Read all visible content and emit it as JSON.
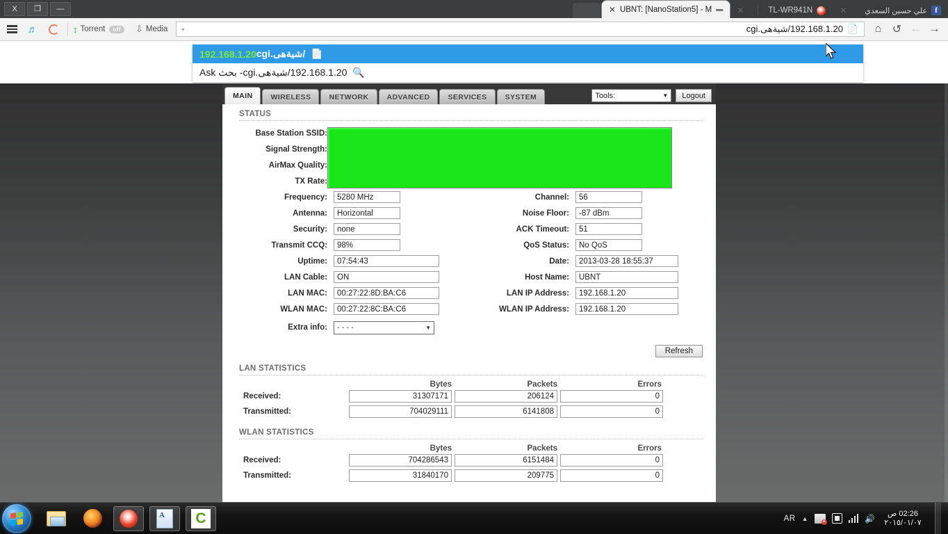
{
  "window": {
    "buttons": [
      {
        "name": "close",
        "glyph": "X"
      },
      {
        "name": "restore",
        "glyph": "❐"
      },
      {
        "name": "minimize",
        "glyph": "—"
      }
    ]
  },
  "browser": {
    "tabs": [
      {
        "id": "blank",
        "title": "",
        "type": "blank"
      },
      {
        "id": "active",
        "title": "UBNT: [NanoStation5] - M",
        "close": "✕",
        "favicon": "▬",
        "type": "active"
      },
      {
        "id": "t2",
        "title": "",
        "close": "✕",
        "type": "dim"
      },
      {
        "id": "t3",
        "title": "TL-WR941N",
        "favicon": "maxthon-icon",
        "type": "plain"
      },
      {
        "id": "t4",
        "title": "",
        "close": "✕",
        "type": "dim"
      },
      {
        "id": "t5",
        "title": "علي حسين السعدي",
        "favicon": "facebook-icon",
        "type": "plain"
      }
    ],
    "toolbar": {
      "menu_icon": "hamburger-icon",
      "headphones_icon": "headphones-icon",
      "maxthon_icon": "maxthon-logo-icon",
      "torrent_label": "Torrent",
      "torrent_state": "off",
      "media_label": "Media",
      "dropdown_caret": "▾"
    },
    "url": {
      "value": "192.168.1.20/شيةهى.cgi",
      "placeholder": "",
      "page_icon": "📄"
    },
    "nav": {
      "home": "⌂",
      "reload": "↺",
      "back": "←",
      "forward": "→"
    },
    "suggestions": [
      {
        "selected": true,
        "icon": "page-icon",
        "main": "192.168.1.20",
        "tail": "/شيةهى.cgi"
      },
      {
        "selected": false,
        "icon": "search-icon",
        "main": "192.168.1.20/شيةهى.cgi",
        "tail": " - بحث Ask"
      }
    ]
  },
  "router": {
    "nav_tabs": [
      {
        "label": "MAIN",
        "selected": true
      },
      {
        "label": "WIRELESS",
        "selected": false
      },
      {
        "label": "NETWORK",
        "selected": false
      },
      {
        "label": "ADVANCED",
        "selected": false
      },
      {
        "label": "SERVICES",
        "selected": false
      },
      {
        "label": "SYSTEM",
        "selected": false
      }
    ],
    "tools_label": "Tools:",
    "logout_label": "Logout",
    "status_title": "STATUS",
    "status_left": [
      {
        "label": "Base Station SSID:",
        "value": "",
        "hidden": true
      },
      {
        "label": "Signal Strength:",
        "value": "",
        "hidden": true
      },
      {
        "label": "AirMax Quality:",
        "value": "",
        "hidden": true
      },
      {
        "label": "TX Rate:",
        "value": "",
        "hidden": true
      },
      {
        "label": "Frequency:",
        "value": "5280 MHz",
        "hidden": false
      },
      {
        "label": "Antenna:",
        "value": "Horizontal",
        "hidden": false
      },
      {
        "label": "Security:",
        "value": "none",
        "hidden": false
      },
      {
        "label": "Transmit CCQ:",
        "value": "98%",
        "hidden": false
      },
      {
        "label": "Uptime:",
        "value": "07:54:43",
        "hidden": false
      },
      {
        "label": "LAN Cable:",
        "value": "ON",
        "hidden": false
      },
      {
        "label": "LAN MAC:",
        "value": "00:27:22:8D:BA:C6",
        "hidden": false
      },
      {
        "label": "WLAN MAC:",
        "value": "00:27:22:8C:BA:C6",
        "hidden": false
      }
    ],
    "status_right": [
      {
        "label": "Channel:",
        "value": "56"
      },
      {
        "label": "Noise Floor:",
        "value": "-87 dBm"
      },
      {
        "label": "ACK Timeout:",
        "value": "51"
      },
      {
        "label": "QoS Status:",
        "value": "No QoS"
      },
      {
        "label": "Date:",
        "value": "2013-03-28 18:55:37"
      },
      {
        "label": "Host Name:",
        "value": "UBNT"
      },
      {
        "label": "LAN IP Address:",
        "value": "192.168.1.20"
      },
      {
        "label": "WLAN IP Address:",
        "value": "192.168.1.20"
      }
    ],
    "extra_info": {
      "label": "Extra info:",
      "value": "- - - -",
      "caret": "▼"
    },
    "refresh_label": "Refresh",
    "lan_stats": {
      "title": "LAN STATISTICS",
      "columns": [
        "Bytes",
        "Packets",
        "Errors"
      ],
      "rows": [
        {
          "label": "Received:",
          "bytes": "31307171",
          "packets": "206124",
          "errors": "0"
        },
        {
          "label": "Transmitted:",
          "bytes": "704029111",
          "packets": "6141808",
          "errors": "0"
        }
      ]
    },
    "wlan_stats": {
      "title": "WLAN STATISTICS",
      "columns": [
        "Bytes",
        "Packets",
        "Errors"
      ],
      "rows": [
        {
          "label": "Received:",
          "bytes": "704286543",
          "packets": "6151484",
          "errors": "0"
        },
        {
          "label": "Transmitted:",
          "bytes": "31840170",
          "packets": "209775",
          "errors": "0"
        }
      ]
    }
  },
  "taskbar": {
    "start_label": "start-orb",
    "apps": [
      {
        "name": "explorer",
        "icon": "folder-icon",
        "open": false
      },
      {
        "name": "firefox",
        "icon": "firefox-icon",
        "open": false
      },
      {
        "name": "maxthon",
        "icon": "maxthon-icon",
        "open": true
      },
      {
        "name": "wordpad",
        "icon": "wordpad-icon",
        "open": true
      },
      {
        "name": "camtasia",
        "icon": "camtasia-icon",
        "open": true
      }
    ],
    "tray": {
      "language": "AR",
      "overflow_caret": "▲",
      "network_icon": "network-disconnected-icon",
      "power_icon": "power-plug-icon",
      "signal_icon": "signal-bars-icon",
      "volume_icon": "volume-icon",
      "time": "02:26 ص",
      "date": "٢٠١٥/٠١/٠٧"
    }
  },
  "colors": {
    "accent_blue": "#2f9ae8",
    "signal_green": "#19e619",
    "suggestion_green": "#7bed2c",
    "taskbar": "#0d0d0d",
    "chrome_dark": "#3b3c3e"
  }
}
